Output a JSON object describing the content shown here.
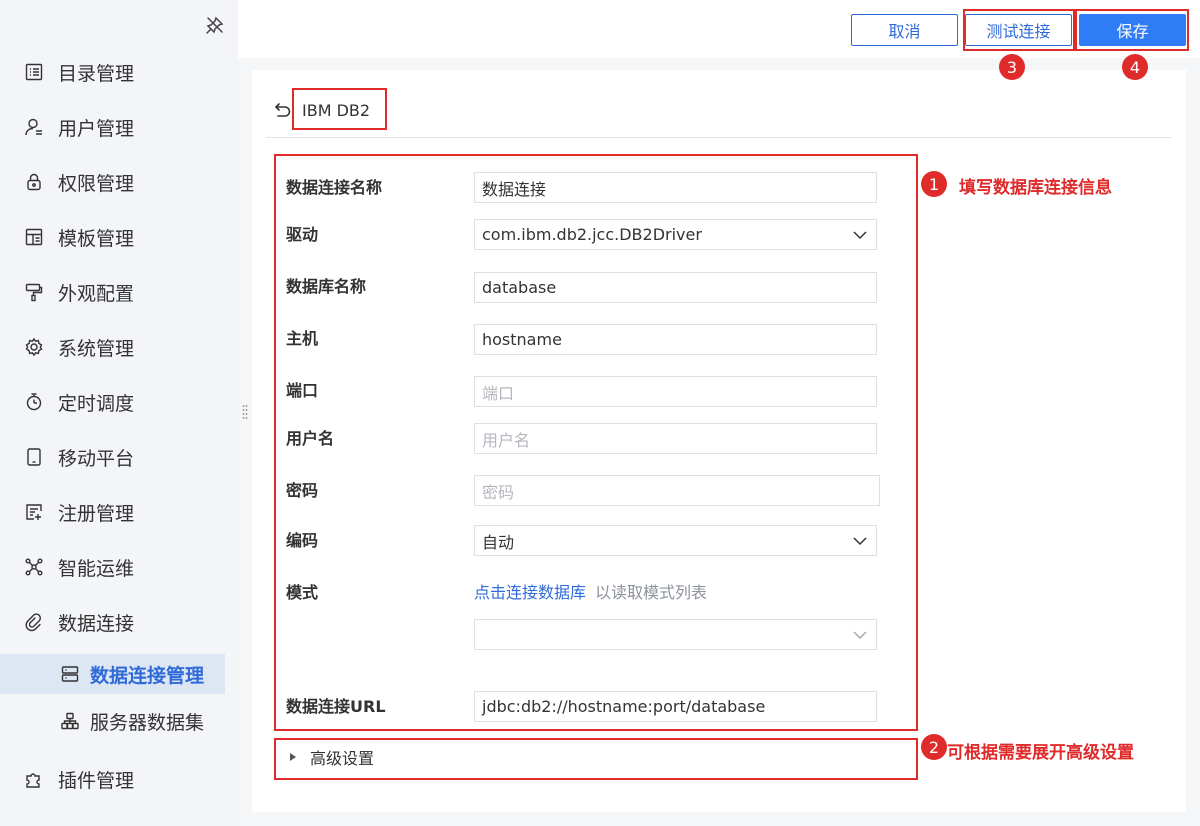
{
  "sidebar": {
    "items": [
      {
        "label": "目录管理",
        "icon": "catalog-icon"
      },
      {
        "label": "用户管理",
        "icon": "user-icon"
      },
      {
        "label": "权限管理",
        "icon": "lock-icon"
      },
      {
        "label": "模板管理",
        "icon": "template-icon"
      },
      {
        "label": "外观配置",
        "icon": "paint-roller-icon"
      },
      {
        "label": "系统管理",
        "icon": "gear-icon"
      },
      {
        "label": "定时调度",
        "icon": "stopwatch-icon"
      },
      {
        "label": "移动平台",
        "icon": "tablet-icon"
      },
      {
        "label": "注册管理",
        "icon": "register-icon"
      },
      {
        "label": "智能运维",
        "icon": "network-icon"
      },
      {
        "label": "数据连接",
        "icon": "link-icon"
      }
    ],
    "subitems": [
      {
        "label": "数据连接管理",
        "icon": "server-icon",
        "active": true
      },
      {
        "label": "服务器数据集",
        "icon": "dataset-icon",
        "active": false
      }
    ],
    "bottom_items": [
      {
        "label": "插件管理",
        "icon": "puzzle-icon"
      }
    ]
  },
  "toolbar": {
    "cancel_label": "取消",
    "test_label": "测试连接",
    "save_label": "保存"
  },
  "header": {
    "db_type": "IBM DB2"
  },
  "form": {
    "conn_name": {
      "label": "数据连接名称",
      "value": "数据连接"
    },
    "driver": {
      "label": "驱动",
      "value": "com.ibm.db2.jcc.DB2Driver"
    },
    "db_name": {
      "label": "数据库名称",
      "value": "database"
    },
    "host": {
      "label": "主机",
      "value": "hostname"
    },
    "port": {
      "label": "端口",
      "placeholder": "端口"
    },
    "username": {
      "label": "用户名",
      "placeholder": "用户名"
    },
    "password": {
      "label": "密码",
      "placeholder": "密码"
    },
    "encoding": {
      "label": "编码",
      "value": "自动"
    },
    "schema": {
      "label": "模式",
      "link": "点击连接数据库",
      "hint": "以读取模式列表",
      "value": ""
    },
    "url": {
      "label": "数据连接URL",
      "value": "jdbc:db2://hostname:port/database"
    },
    "advanced_label": "高级设置"
  },
  "annotations": {
    "badge1": "1",
    "badge2": "2",
    "badge3": "3",
    "badge4": "4",
    "note1": "填写数据库连接信息",
    "note2": "可根据需要展开高级设置"
  },
  "colors": {
    "accent": "#2f6bd8",
    "save_bg": "#2f7cf6",
    "annotation_red": "#e02b2b",
    "active_bg": "#dde6f3"
  }
}
